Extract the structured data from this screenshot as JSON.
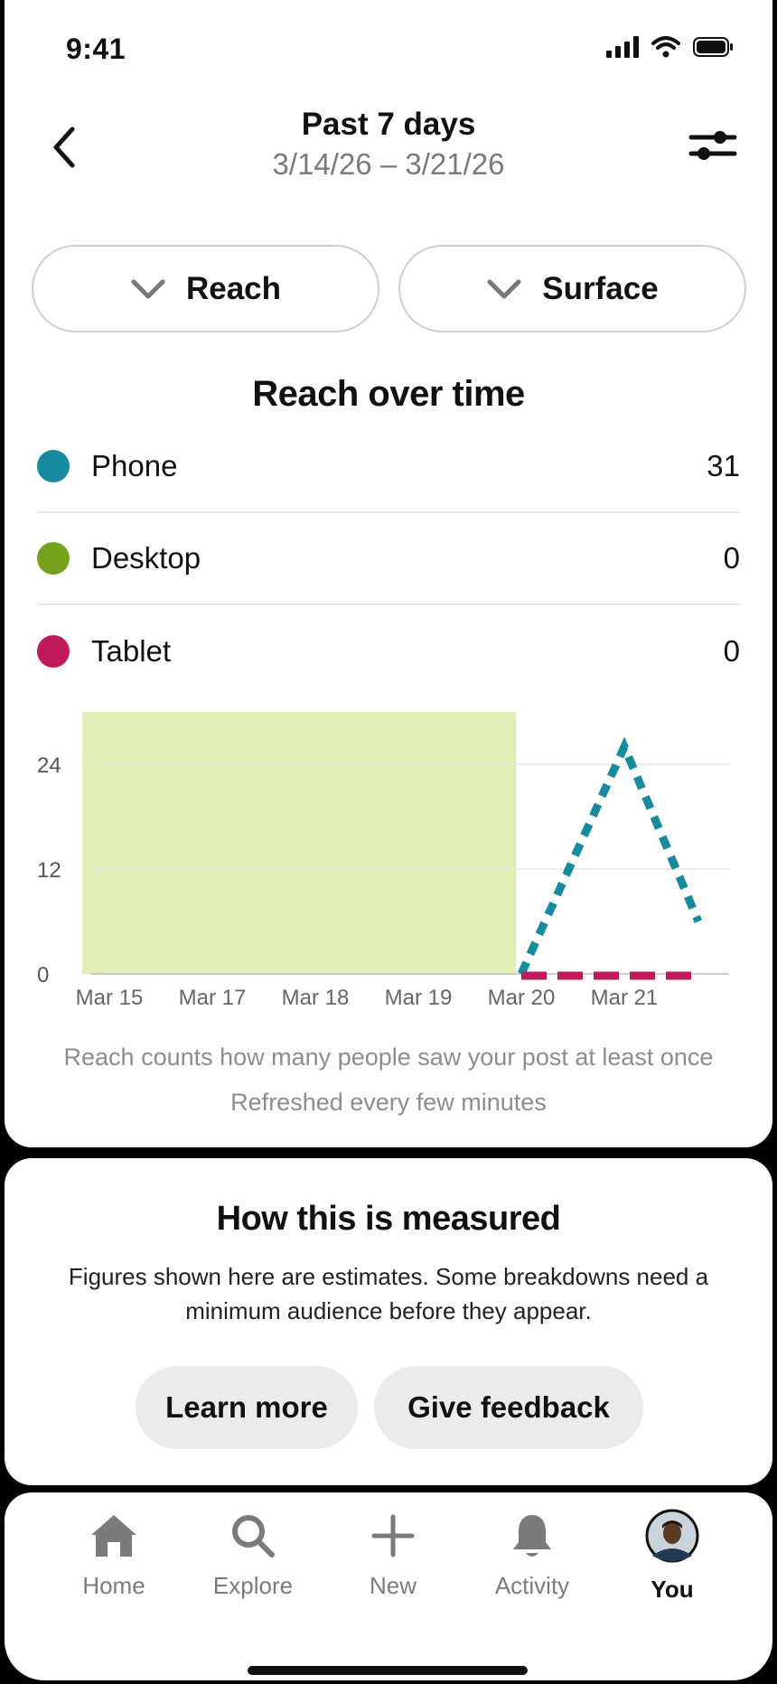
{
  "status_bar": {
    "time": "9:41"
  },
  "header": {
    "title": "Past 7 days",
    "date_range": "3/14/26 – 3/21/26"
  },
  "dropdowns": {
    "metric": "Reach",
    "surface": "Surface"
  },
  "section_title": "Reach over time",
  "legend": [
    {
      "name": "Phone",
      "value": "31",
      "color": "#178b9e"
    },
    {
      "name": "Desktop",
      "value": "0",
      "color": "#74a01a"
    },
    {
      "name": "Tablet",
      "value": "0",
      "color": "#c01a5b"
    }
  ],
  "chart_data": {
    "type": "line",
    "title": "",
    "xlabel": "",
    "ylabel": "",
    "x_ticks": [
      "Mar 15",
      "Mar 17",
      "Mar 18",
      "Mar 19",
      "Mar 20",
      "Mar 21"
    ],
    "y_ticks": [
      0,
      12,
      24
    ],
    "ylim": [
      0,
      30
    ],
    "grid": true,
    "shaded_region": {
      "from": "Mar 15",
      "to": "Mar 20",
      "color": "#dfeeb5"
    },
    "series": [
      {
        "name": "Phone",
        "color": "#178b9e",
        "style": "dashed",
        "points": [
          {
            "x": "Mar 20",
            "y": 0
          },
          {
            "x": "Mar 21",
            "y": 26
          },
          {
            "x": "Mar 22",
            "y": 6
          }
        ]
      },
      {
        "name": "Tablet",
        "color": "#c01a5b",
        "style": "dashed",
        "points": [
          {
            "x": "Mar 20",
            "y": 0
          },
          {
            "x": "Mar 21",
            "y": 0
          },
          {
            "x": "Mar 22",
            "y": 0
          }
        ]
      }
    ]
  },
  "notes": {
    "reach_definition": "Reach counts how many people saw your post at least once",
    "refresh": "Refreshed every few minutes"
  },
  "info_card": {
    "title": "How this is measured",
    "body": "Figures shown here are estimates. Some breakdowns need a minimum audience before they appear.",
    "learn_more": "Learn more",
    "give_feedback": "Give feedback"
  },
  "nav": {
    "home": "Home",
    "explore": "Explore",
    "new": "New",
    "activity": "Activity",
    "you": "You"
  }
}
